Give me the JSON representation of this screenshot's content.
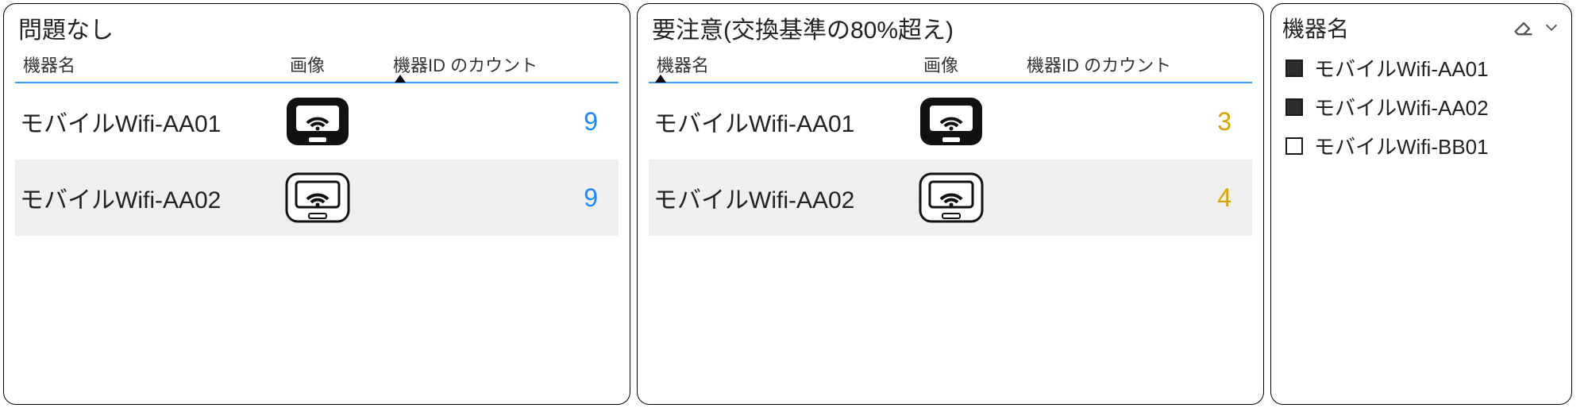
{
  "panels": [
    {
      "title": "問題なし",
      "count_color": "count-blue",
      "columns": {
        "name": "機器名",
        "image": "画像",
        "count": "機器ID のカウント"
      },
      "sort_on": "count",
      "rows": [
        {
          "name": "モバイルWifi-AA01",
          "icon_variant": "dark",
          "count": "9"
        },
        {
          "name": "モバイルWifi-AA02",
          "icon_variant": "light",
          "count": "9"
        }
      ]
    },
    {
      "title": "要注意(交換基準の80%超え)",
      "count_color": "count-yellow",
      "columns": {
        "name": "機器名",
        "image": "画像",
        "count": "機器ID のカウント"
      },
      "sort_on": "name",
      "rows": [
        {
          "name": "モバイルWifi-AA01",
          "icon_variant": "dark",
          "count": "3"
        },
        {
          "name": "モバイルWifi-AA02",
          "icon_variant": "light",
          "count": "4"
        }
      ]
    }
  ],
  "legend": {
    "title": "機器名",
    "items": [
      {
        "label": "モバイルWifi-AA01",
        "filled": true
      },
      {
        "label": "モバイルWifi-AA02",
        "filled": true
      },
      {
        "label": "モバイルWifi-BB01",
        "filled": false
      }
    ]
  },
  "colors": {
    "accent_blue": "#1b87ff",
    "warn_yellow": "#d8a400",
    "header_rule": "#3aa0ff"
  }
}
